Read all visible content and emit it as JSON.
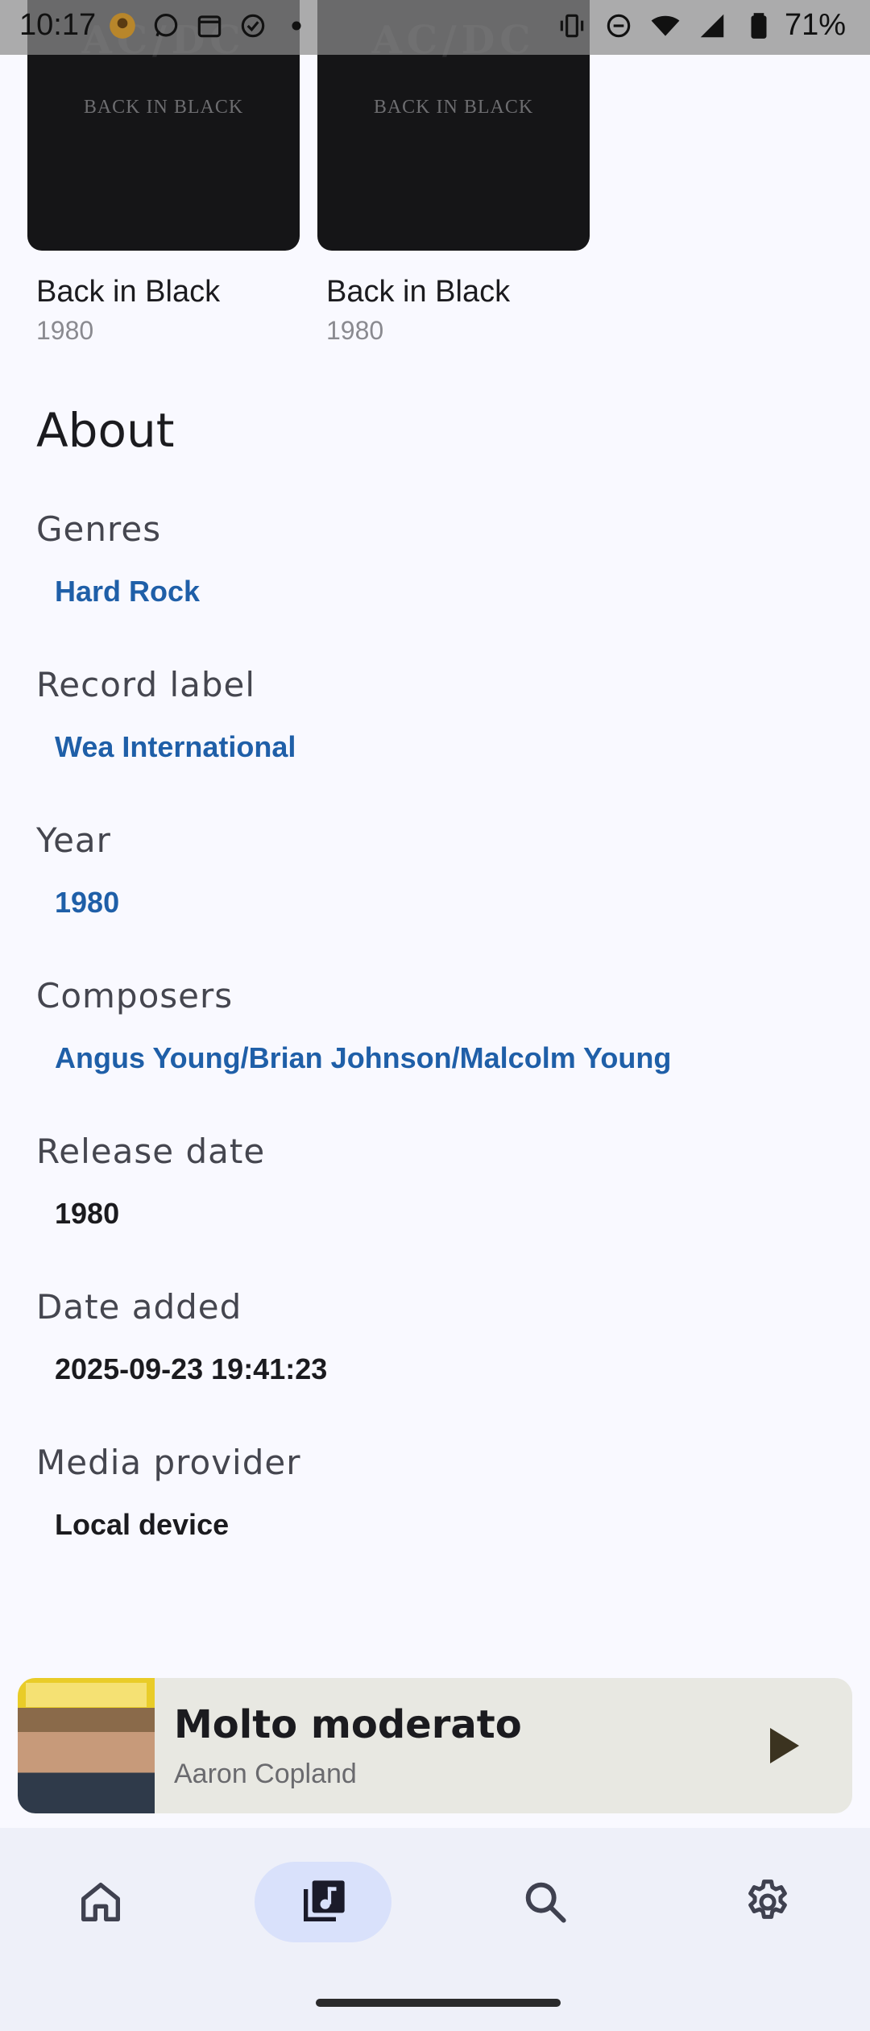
{
  "status_bar": {
    "time": "10:17",
    "battery_percent": "71%"
  },
  "albums": [
    {
      "title": "Back in Black",
      "year": "1980",
      "cover_logo": "AC/DC",
      "cover_text": "BACK IN BLACK"
    },
    {
      "title": "Back in Black",
      "year": "1980",
      "cover_logo": "AC/DC",
      "cover_text": "BACK IN BLACK"
    }
  ],
  "about": {
    "heading": "About",
    "sections": [
      {
        "label": "Genres",
        "value": "Hard Rock",
        "link": true
      },
      {
        "label": "Record label",
        "value": "Wea International",
        "link": true
      },
      {
        "label": "Year",
        "value": "1980",
        "link": true
      },
      {
        "label": "Composers",
        "value": "Angus Young/Brian Johnson/Malcolm Young",
        "link": true
      },
      {
        "label": "Release date",
        "value": "1980",
        "link": false
      },
      {
        "label": "Date added",
        "value": "2025-09-23 19:41:23",
        "link": false
      },
      {
        "label": "Media provider",
        "value": "Local device",
        "link": false
      }
    ]
  },
  "mini_player": {
    "title": "Molto moderato",
    "artist": "Aaron Copland",
    "play_icon": "play-icon"
  },
  "bottom_nav": {
    "items": [
      {
        "name": "home",
        "icon": "home-icon",
        "selected": false
      },
      {
        "name": "library",
        "icon": "music-library-icon",
        "selected": true
      },
      {
        "name": "search",
        "icon": "search-icon",
        "selected": false
      },
      {
        "name": "settings",
        "icon": "gear-icon",
        "selected": false
      }
    ]
  },
  "colors": {
    "background": "#f9f9ff",
    "link": "#1f5fa8",
    "nav_selected": "#d9e1fb",
    "mini_player_bg": "#e8e8e2"
  }
}
